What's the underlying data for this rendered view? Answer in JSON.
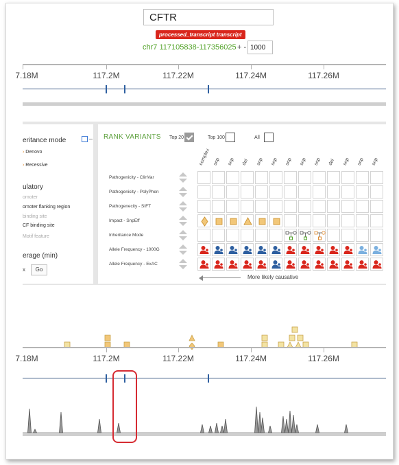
{
  "header": {
    "gene": "CFTR",
    "transcript_badge": "processed_transcript transcript",
    "region": "chr7 117105838-117356025",
    "plus_minus": "+ -",
    "padding_value": "1000"
  },
  "axis_labels": [
    "7.18M",
    "117.2M",
    "117.22M",
    "117.24M",
    "117.26M"
  ],
  "filters": {
    "header_items": [
      {
        "cls": "lp-h",
        "text": "eritance mode"
      },
      {
        "cls": "lp-s",
        "text": "Denovo",
        "dot": "›"
      },
      {
        "cls": "lp-s",
        "text": "Recessive",
        "dot": "›"
      },
      {
        "cls": "lp-h",
        "text": "ulatory"
      },
      {
        "cls": "lp-f",
        "text": "omoter"
      },
      {
        "cls": "lp-s",
        "text": "omoter flanking region"
      },
      {
        "cls": "lp-f",
        "text": "binding site"
      },
      {
        "cls": "lp-s",
        "text": "CF binding site"
      },
      {
        "cls": "lp-f",
        "text": "Motif feature"
      },
      {
        "cls": "lp-h",
        "text": "erage (min)"
      }
    ],
    "coverage_prefix": "x",
    "go_label": "Go"
  },
  "rank": {
    "title": "RANK VARIANTS",
    "options": [
      {
        "label": "Top 20",
        "checked": true
      },
      {
        "label": "Top 100",
        "checked": false
      },
      {
        "label": "All",
        "checked": false
      }
    ],
    "columns": [
      "complex",
      "snp",
      "snp",
      "del",
      "snp",
      "snp",
      "snp",
      "snp",
      "snp",
      "del",
      "snp",
      "snp",
      "snp"
    ],
    "rows": [
      {
        "label": "Pathogenicity - ClinVar",
        "cells": [
          "",
          "",
          "",
          "",
          "",
          "",
          "",
          "",
          "",
          "",
          "",
          "",
          ""
        ]
      },
      {
        "label": "Pathogenicity - PolyPhen",
        "cells": [
          "",
          "",
          "",
          "",
          "",
          "",
          "",
          "",
          "",
          "",
          "",
          "",
          ""
        ]
      },
      {
        "label": "Pathogenecity - SIFT",
        "cells": [
          "",
          "",
          "",
          "",
          "",
          "",
          "",
          "",
          "",
          "",
          "",
          "",
          ""
        ]
      },
      {
        "label": "Impact - SnpEff",
        "cells": [
          "diamond",
          "square",
          "square",
          "triangle",
          "square",
          "square",
          "",
          "",
          "",
          "",
          "",
          "",
          ""
        ]
      },
      {
        "label": "Inheritance Mode",
        "cells": [
          "",
          "",
          "",
          "",
          "",
          "",
          "pedigree",
          "pedigree",
          "pedigree-o",
          "",
          "",
          "",
          ""
        ]
      },
      {
        "label": "Allele Frequency - 1000G",
        "cells": [
          "person-red",
          "person-blue",
          "person-blue",
          "person-blue",
          "person-blue",
          "person-blue",
          "person-red",
          "person-red",
          "person-red",
          "person-red",
          "person-red",
          "person-lblue",
          "person-lblue"
        ]
      },
      {
        "label": "Allele Frequency - ExAC",
        "cells": [
          "person-red",
          "person-red",
          "person-red",
          "person-red",
          "person-red",
          "person-blue",
          "person-red",
          "person-red",
          "person-red",
          "person-red",
          "person-red",
          "person-red",
          "person-red"
        ]
      }
    ],
    "causative_label": "More likely causative"
  },
  "colors": {
    "green": "#5a9f3a",
    "red": "#d9261c",
    "blue_person": "#2e5fa0",
    "light_blue_person": "#7bb0df",
    "orange": "#e0a040",
    "impact_fill": "#f2c779",
    "variant_yellow": "#f3e3a3"
  }
}
